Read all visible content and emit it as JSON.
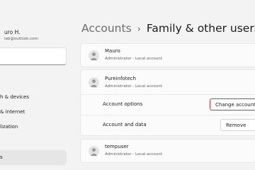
{
  "sidebar": {
    "profile": {
      "name": "uro H.",
      "email": "lab@outlook.com"
    },
    "search": {
      "placeholder": ""
    },
    "items": [
      {
        "label": "h & devices"
      },
      {
        "label": "& internet"
      },
      {
        "label": "lization"
      },
      {
        "label": "s"
      }
    ]
  },
  "header": {
    "breadcrumb_parent": "Accounts",
    "breadcrumb_separator": "›",
    "title": "Family & other users"
  },
  "users": [
    {
      "name": "Mauro",
      "type": "Administrator - Local account"
    },
    {
      "name": "Pureinfotech",
      "type": "Administrator - Local account"
    },
    {
      "name": "tempuser",
      "type": "Administrator - Local account"
    }
  ],
  "options": {
    "account_options_label": "Account options",
    "change_account_type_button": "Change account",
    "account_data_label": "Account and data",
    "remove_button": "Remove"
  },
  "colors": {
    "highlight": "#d63a2f",
    "background": "#f3f3f3",
    "card": "#fbfbfb"
  }
}
